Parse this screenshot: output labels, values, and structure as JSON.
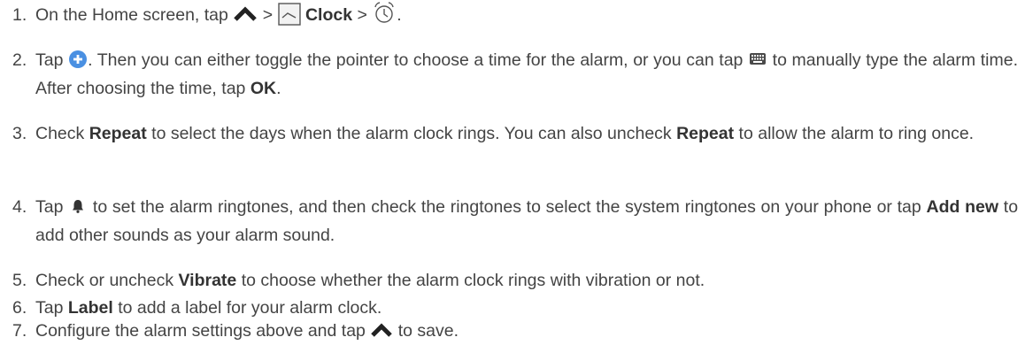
{
  "steps": [
    {
      "num": "1.",
      "parts": [
        "On the Home screen, tap",
        ">",
        "Clock",
        ">",
        "."
      ]
    },
    {
      "num": "2.",
      "parts": [
        "Tap",
        ". Then you can either toggle the pointer to choose a time for the alarm, or you can tap",
        "to manually type the alarm time. After choosing the time, tap",
        "OK",
        "."
      ]
    },
    {
      "num": "3.",
      "parts": [
        "Check",
        "Repeat",
        "to select the days when the alarm clock rings. You can also uncheck",
        "Repeat",
        "to allow the alarm to ring once."
      ]
    },
    {
      "num": "4.",
      "parts": [
        "Tap",
        "to set the alarm ringtones, and then check the ringtones to select the system ringtones on your phone or tap",
        "Add new",
        "to add other sounds as your alarm sound."
      ]
    },
    {
      "num": "5.",
      "parts": [
        "Check or uncheck",
        "Vibrate",
        "to choose whether the alarm clock rings with vibration or not."
      ]
    },
    {
      "num": "6.",
      "parts": [
        "Tap",
        "Label",
        "to add a label for your alarm clock."
      ]
    },
    {
      "num": "7.",
      "parts": [
        "Configure the alarm settings above and tap",
        "to save."
      ]
    }
  ],
  "icons": {
    "up_arrow": "chevron-up-icon",
    "clock_app": "clock-app-icon",
    "alarm": "alarm-clock-icon",
    "add": "add-circle-icon",
    "keyboard": "keyboard-icon",
    "ringtone": "bell-icon"
  },
  "colors": {
    "text": "#444444",
    "bold": "#333333",
    "add_icon": "#4a90e2"
  }
}
